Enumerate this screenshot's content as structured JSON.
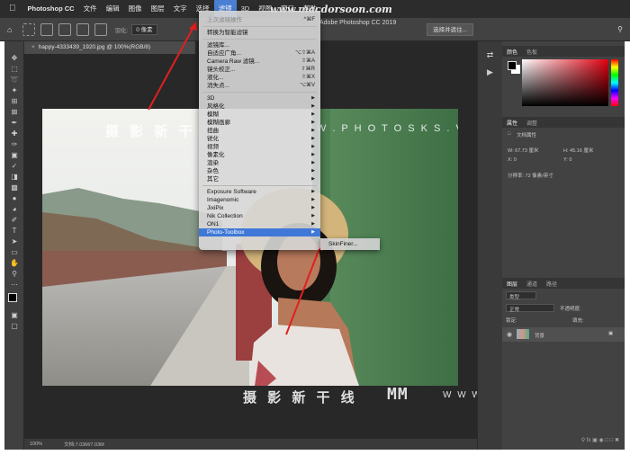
{
  "macbar": {
    "items": [
      "",
      "Photoshop CC",
      "文件",
      "编辑",
      "图像",
      "图层",
      "文字",
      "选择",
      "滤镜",
      "3D",
      "视图",
      "窗口",
      "帮助"
    ],
    "active_index": 8
  },
  "options": {
    "feather_label": "羽化:",
    "feather_value": "0 像素",
    "select_mask_label": "选择并遮住..."
  },
  "window": {
    "title": "Adobe Photoshop CC 2019"
  },
  "document": {
    "tab_label": "happy-4333439_1920.jpg @ 100%(RGB/8)",
    "zoom": "100%",
    "doc_size": "文档:7.03M/7.03M"
  },
  "filter_menu": {
    "items": [
      {
        "label": "上次滤镜操作",
        "shortcut": "^⌘F",
        "disabled": true
      },
      {
        "sep": true
      },
      {
        "label": "转换为智能滤镜"
      },
      {
        "sep": true
      },
      {
        "label": "滤镜库..."
      },
      {
        "label": "自适应广角...",
        "shortcut": "⌥⇧⌘A"
      },
      {
        "label": "Camera Raw 滤镜...",
        "shortcut": "⇧⌘A"
      },
      {
        "label": "镜头校正...",
        "shortcut": "⇧⌘R"
      },
      {
        "label": "液化...",
        "shortcut": "⇧⌘X"
      },
      {
        "label": "消失点...",
        "shortcut": "⌥⌘V"
      },
      {
        "sep": true
      },
      {
        "label": "3D",
        "sub": true
      },
      {
        "label": "风格化",
        "sub": true
      },
      {
        "label": "模糊",
        "sub": true
      },
      {
        "label": "模糊画廊",
        "sub": true
      },
      {
        "label": "扭曲",
        "sub": true
      },
      {
        "label": "锐化",
        "sub": true
      },
      {
        "label": "视频",
        "sub": true
      },
      {
        "label": "像素化",
        "sub": true
      },
      {
        "label": "渲染",
        "sub": true
      },
      {
        "label": "杂色",
        "sub": true
      },
      {
        "label": "其它",
        "sub": true
      },
      {
        "sep": true
      },
      {
        "label": "Exposure Software",
        "sub": true
      },
      {
        "label": "Imagenomic",
        "sub": true
      },
      {
        "label": "JixiPix",
        "sub": true
      },
      {
        "label": "Nik Collection",
        "sub": true
      },
      {
        "label": "ON1",
        "sub": true
      },
      {
        "label": "Photo-Toolbox",
        "sub": true,
        "highlighted": true
      }
    ],
    "submenu_item": "SkinFiner..."
  },
  "panels": {
    "color_tabs": [
      "颜色",
      "色板"
    ],
    "props_tabs": [
      "属性",
      "调整"
    ],
    "props_title": "文档属性",
    "width": "W: 67.73 厘米",
    "height": "H: 45.16 厘米",
    "x": "X: 0",
    "y": "Y: 0",
    "resolution": "分辨率: 72 像素/英寸",
    "layer_tabs": [
      "图层",
      "通道",
      "路径"
    ],
    "layer_kind": "类型",
    "blend_mode": "正常",
    "opacity": "不透明度:",
    "lock_label": "锁定:",
    "fill_label": "填充:",
    "layer_name": "背景"
  },
  "watermarks": {
    "site_cn": "摄 影 新 干 线",
    "site_en": "W W W . P H O T O S K S . V I P",
    "site_top": "www.macdorsoon.com",
    "mark": "MM"
  }
}
